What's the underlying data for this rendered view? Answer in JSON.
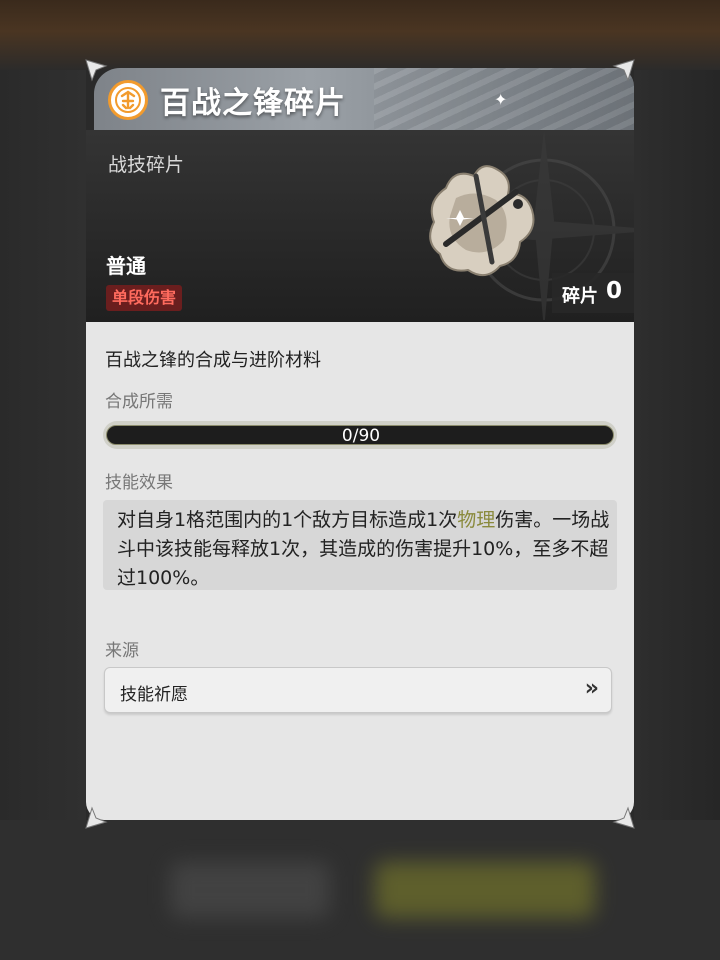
{
  "item": {
    "name": "百战之锋碎片",
    "category": "战技碎片",
    "rarity": "普通",
    "damage_type": "单段伤害",
    "count_label": "碎片",
    "count_value": "0"
  },
  "details": {
    "purpose": "百战之锋的合成与进阶材料",
    "synthesis_label": "合成所需",
    "progress_text": "0/90",
    "progress_fraction": 0,
    "effect_label": "技能效果",
    "effect_part1": "对自身1格范围内的1个敌方目标造成1次",
    "effect_keyword": "物理",
    "effect_part2": "伤害。一场战斗中该技能每释放1次，其造成的伤害提升10%，至多不超过100%。",
    "source_label": "来源",
    "source_item": "技能祈愿",
    "source_arrow_icon": "double-chevron-right-icon"
  },
  "colors": {
    "badge_text": "#ff6b5e",
    "badge_bg": "#6a1e1e",
    "keyword": "#8a8a3c",
    "emblem_ring": "#f29b2d"
  }
}
